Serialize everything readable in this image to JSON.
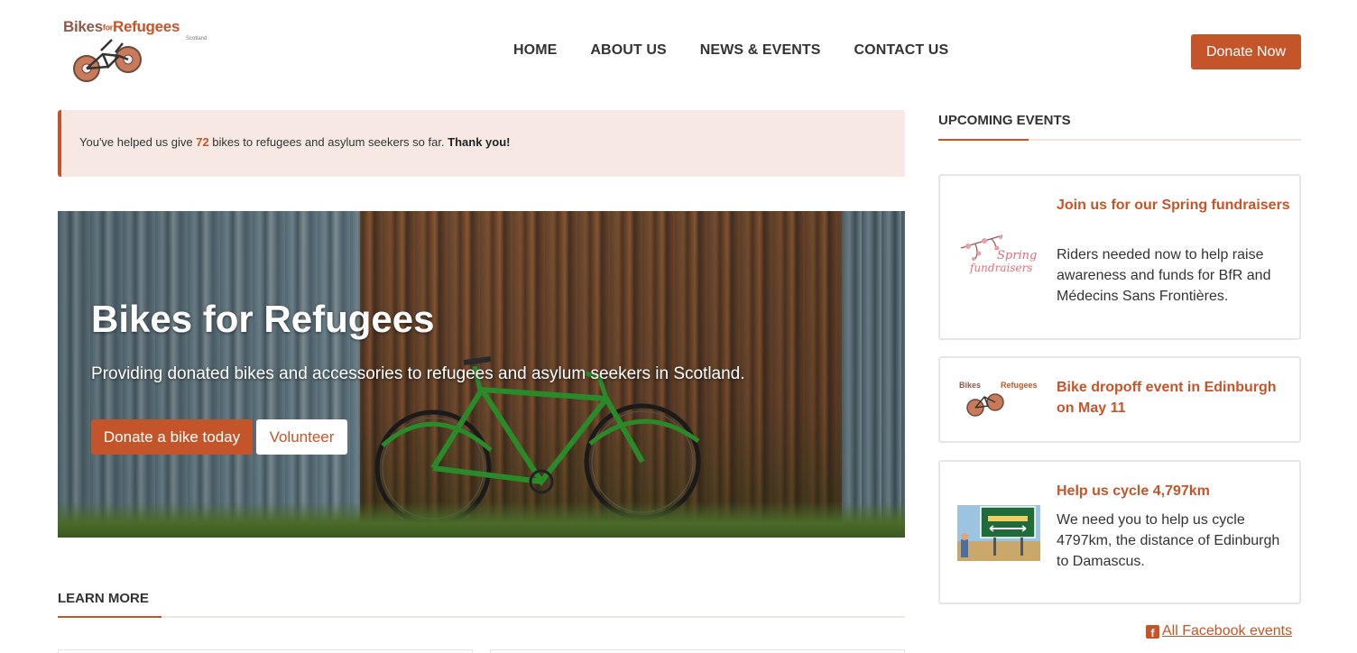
{
  "brand": {
    "logo_part1": "Bikes",
    "logo_part2": "for",
    "logo_part3": "Refugees",
    "logo_sub": "Scotland",
    "accent_color": "#c4552a"
  },
  "nav": {
    "items": [
      "HOME",
      "ABOUT US",
      "NEWS & EVENTS",
      "CONTACT US"
    ],
    "donate_label": "Donate Now"
  },
  "alert": {
    "text_before": "You've helped us give ",
    "count": "72",
    "text_after": " bikes to refugees and asylum seekers so far. ",
    "thanks": "Thank you!"
  },
  "hero": {
    "title": "Bikes for Refugees",
    "subtitle": "Providing donated bikes and accessories to refugees and asylum seekers in Scotland.",
    "primary_button": "Donate a bike today",
    "secondary_button": "Volunteer"
  },
  "learn_more": {
    "heading": "LEARN MORE"
  },
  "sidebar": {
    "heading": "UPCOMING EVENTS",
    "events": [
      {
        "title": "Join us for our Spring fundraisers",
        "description": "Riders needed now to help raise awareness and funds for BfR and Médecins Sans Frontières.",
        "thumb_text_1": "Spring",
        "thumb_text_2": "fundraisers",
        "thumb_icon": "cherry-blossom-icon"
      },
      {
        "title": "Bike dropoff event in Edinburgh on May 11",
        "description": "",
        "thumb_text_1": "Bikes",
        "thumb_text_2": "Refugees",
        "thumb_icon": "logo-thumbnail-icon"
      },
      {
        "title": "Help us cycle 4,797km",
        "description": "We need you to help us cycle 4797km, the distance of Edinburgh to Damascus.",
        "thumb_icon": "road-sign-photo-icon"
      }
    ],
    "facebook_link": "All Facebook events"
  }
}
